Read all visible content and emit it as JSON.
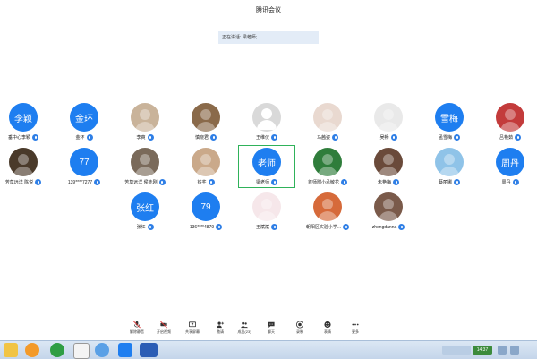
{
  "window": {
    "title": "腾讯会议"
  },
  "speaking": {
    "label": "正在讲话: 梁老师;"
  },
  "participants": [
    {
      "name": "垂中心李颖",
      "avatar_text": "李颖",
      "avatar": "text"
    },
    {
      "name": "金环",
      "avatar_text": "金环",
      "avatar": "text"
    },
    {
      "name": "李爽",
      "avatar_text": "",
      "avatar": "photo"
    },
    {
      "name": "慎晓君",
      "avatar_text": "",
      "avatar": "photo"
    },
    {
      "name": "王维仪",
      "avatar_text": "",
      "avatar": "default"
    },
    {
      "name": "马茜姿",
      "avatar_text": "",
      "avatar": "photo"
    },
    {
      "name": "吴畅",
      "avatar_text": "",
      "avatar": "photo"
    },
    {
      "name": "孟雪梅",
      "avatar_text": "雪梅",
      "avatar": "text"
    },
    {
      "name": "吕艳茹",
      "avatar_text": "",
      "avatar": "photo"
    },
    {
      "name": "芳草远洋 陈悦",
      "avatar_text": "",
      "avatar": "photo"
    },
    {
      "name": "139****7277",
      "avatar_text": "77",
      "avatar": "text"
    },
    {
      "name": "芳草远洋 侯赤刚",
      "avatar_text": "",
      "avatar": "photo"
    },
    {
      "name": "铁芊",
      "avatar_text": "",
      "avatar": "photo"
    },
    {
      "name": "梁老师",
      "avatar_text": "老师",
      "avatar": "text"
    },
    {
      "name": "首师附小孟敏花",
      "avatar_text": "",
      "avatar": "photo"
    },
    {
      "name": "朱艳梅",
      "avatar_text": "",
      "avatar": "photo"
    },
    {
      "name": "蔡丽娜",
      "avatar_text": "",
      "avatar": "photo"
    },
    {
      "name": "周丹",
      "avatar_text": "周丹",
      "avatar": "text"
    },
    {
      "name": "张红",
      "avatar_text": "张红",
      "avatar": "text"
    },
    {
      "name": "136****4879",
      "avatar_text": "79",
      "avatar": "text"
    },
    {
      "name": "王斌斌",
      "avatar_text": "",
      "avatar": "photo"
    },
    {
      "name": "朝阳区实验小学...",
      "avatar_text": "",
      "avatar": "photo"
    },
    {
      "name": "zhengdanna",
      "avatar_text": "",
      "avatar": "photo"
    }
  ],
  "toolbar": {
    "mute": "解除静音",
    "video": "开启视频",
    "share": "共享屏幕",
    "invite": "邀请",
    "members": "成员(23)",
    "chat": "聊天",
    "record": "录制",
    "expression": "表情",
    "more": "更多"
  },
  "taskbar": {
    "clock": "14:37"
  },
  "colors": {
    "accent": "#1e7ef0",
    "active_border": "#2fb25a",
    "speaking_bg": "#e3ecf7"
  }
}
